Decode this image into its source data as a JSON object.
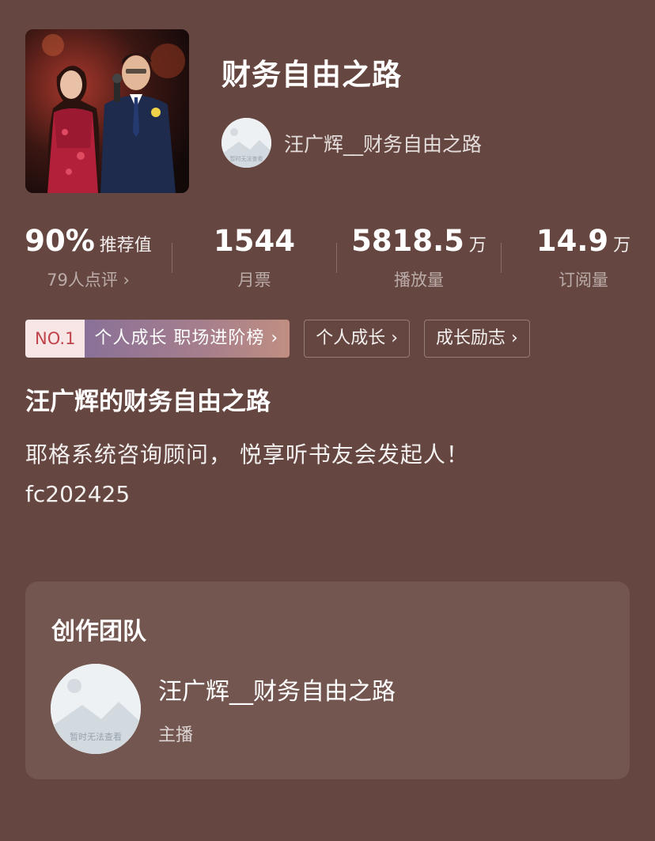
{
  "album": {
    "title": "财务自由之路",
    "author_name": "汪广辉__财务自由之路",
    "avatar_placeholder": "暂时无法查看"
  },
  "stats": [
    {
      "value": "90%",
      "unit": "推荐值",
      "label": "79人点评 ›"
    },
    {
      "value": "1544",
      "unit": "",
      "label": "月票"
    },
    {
      "value": "5818.5",
      "unit": "万",
      "label": "播放量"
    },
    {
      "value": "14.9",
      "unit": "万",
      "label": "订阅量"
    }
  ],
  "tags": {
    "rank_no": "NO.1",
    "rank_name": "个人成长 职场进阶榜 ›",
    "categories": [
      "个人成长 ›",
      "成长励志 ›"
    ]
  },
  "intro": {
    "title": "汪广辉的财务自由之路",
    "description": "耶格系统咨询顾问， 悦享听书友会发起人！",
    "code": "fc202425"
  },
  "team": {
    "heading": "创作团队",
    "members": [
      {
        "name": "汪广辉__财务自由之路",
        "role": "主播",
        "avatar_placeholder": "暂时无法查看"
      }
    ]
  }
}
